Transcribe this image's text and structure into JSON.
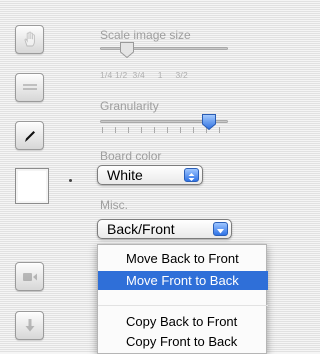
{
  "toolbar": {
    "tools": [
      {
        "icon": "hand-icon",
        "enabled": false
      },
      {
        "icon": "eraser-icon",
        "enabled": false
      },
      {
        "icon": "pencil-icon",
        "enabled": true
      }
    ],
    "swatch_color": "#ffffff",
    "bottom_tools": [
      {
        "icon": "record-icon",
        "enabled": false
      },
      {
        "icon": "download-icon",
        "enabled": false
      }
    ]
  },
  "scale": {
    "label": "Scale image size",
    "tick_labels": "1/4 1/2  3/4     1     3/2",
    "value": "1/2"
  },
  "granularity": {
    "label": "Granularity",
    "value_fraction": 0.8
  },
  "board_color": {
    "label": "Board color",
    "selected": "White"
  },
  "misc": {
    "label": "Misc.",
    "selected": "Back/Front",
    "menu_items": [
      "Move Back to Front",
      "Move Front to Back",
      "Copy Back to Front",
      "Copy Front to Back"
    ],
    "highlighted_index": 1
  },
  "colors": {
    "accent": "#2f6fd8",
    "label_gray": "#9e9e9e"
  }
}
